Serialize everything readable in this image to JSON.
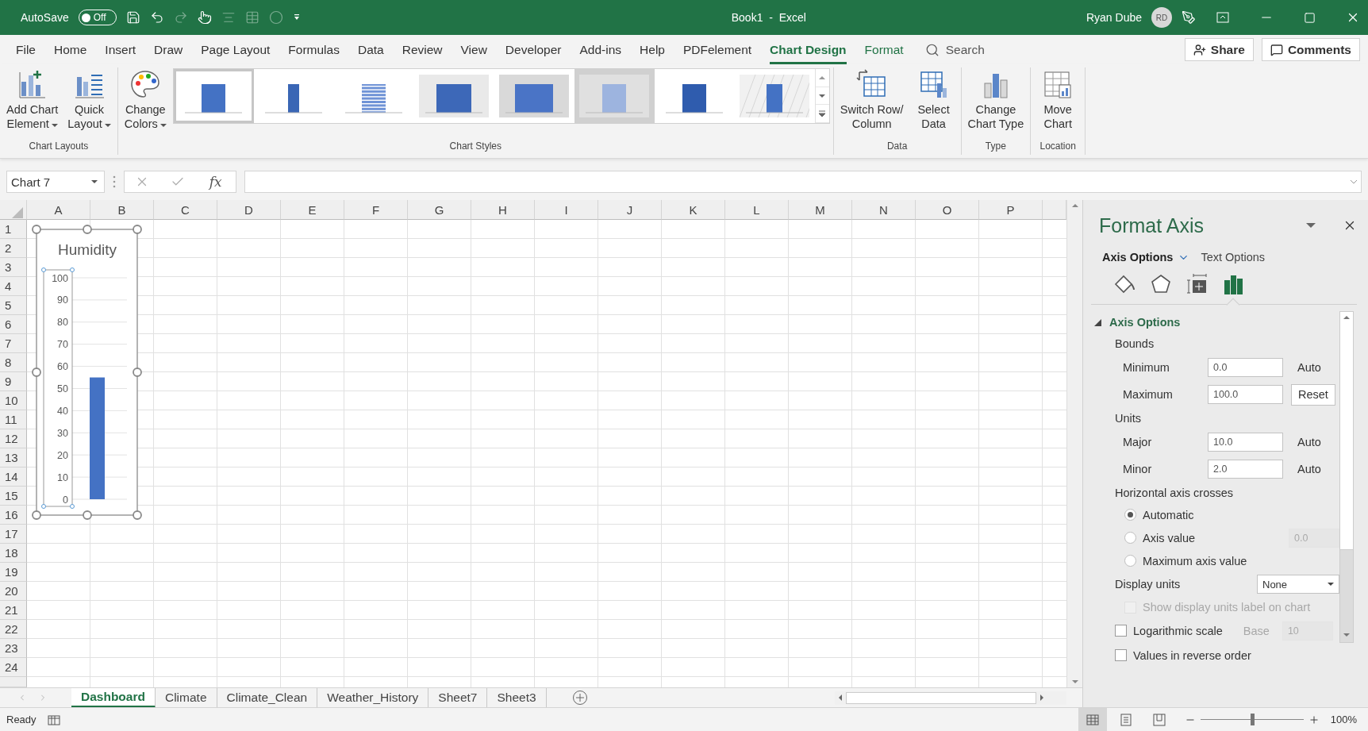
{
  "title_bar": {
    "autosave_label": "AutoSave",
    "autosave_toggle": {
      "label": "Off",
      "on": false
    },
    "quick_access": [
      {
        "kind": "save",
        "disabled": false
      },
      {
        "kind": "undo",
        "disabled": false
      },
      {
        "kind": "redo",
        "disabled": true
      },
      {
        "kind": "touch",
        "disabled": false
      },
      {
        "kind": "align",
        "disabled": true
      },
      {
        "kind": "table",
        "disabled": true
      },
      {
        "kind": "circle",
        "disabled": true
      },
      {
        "kind": "customize",
        "disabled": false
      }
    ],
    "document_title": "Book1  -  Excel",
    "user_name": "Ryan Dube",
    "user_initials": "RD"
  },
  "menu_tabs": [
    {
      "label": "File",
      "kind": "regular",
      "selected": false
    },
    {
      "label": "Home",
      "kind": "regular",
      "selected": false
    },
    {
      "label": "Insert",
      "kind": "regular",
      "selected": false
    },
    {
      "label": "Draw",
      "kind": "regular",
      "selected": false
    },
    {
      "label": "Page Layout",
      "kind": "regular",
      "selected": false
    },
    {
      "label": "Formulas",
      "kind": "regular",
      "selected": false
    },
    {
      "label": "Data",
      "kind": "regular",
      "selected": false
    },
    {
      "label": "Review",
      "kind": "regular",
      "selected": false
    },
    {
      "label": "View",
      "kind": "regular",
      "selected": false
    },
    {
      "label": "Developer",
      "kind": "regular",
      "selected": false
    },
    {
      "label": "Add-ins",
      "kind": "regular",
      "selected": false
    },
    {
      "label": "Help",
      "kind": "regular",
      "selected": false
    },
    {
      "label": "PDFelement",
      "kind": "regular",
      "selected": false
    },
    {
      "label": "Chart Design",
      "kind": "contextual",
      "selected": true
    },
    {
      "label": "Format",
      "kind": "contextual",
      "selected": false
    }
  ],
  "search": {
    "label": "Search"
  },
  "share_button": "Share",
  "comments_button": "Comments",
  "ribbon": {
    "groups": [
      {
        "label": "Chart Layouts",
        "buttons": [
          {
            "kind": "add_element",
            "lines": [
              "Add Chart",
              "Element"
            ],
            "dropdown": true
          },
          {
            "kind": "quick_layout",
            "lines": [
              "Quick",
              "Layout"
            ],
            "dropdown": true
          }
        ]
      },
      {
        "label": "Chart Styles",
        "buttons": [
          {
            "kind": "change_colors",
            "lines": [
              "Change",
              "Colors"
            ],
            "dropdown": true
          }
        ],
        "gallery": [
          {
            "kind": "plain",
            "selected": true,
            "highlighted": false
          },
          {
            "kind": "narrow",
            "selected": false,
            "highlighted": false
          },
          {
            "kind": "striped",
            "selected": false,
            "highlighted": false
          },
          {
            "kind": "gradient",
            "selected": false,
            "highlighted": false
          },
          {
            "kind": "wide",
            "selected": false,
            "highlighted": false
          },
          {
            "kind": "light",
            "selected": false,
            "highlighted": true
          },
          {
            "kind": "solid",
            "selected": false,
            "highlighted": false
          },
          {
            "kind": "hatched",
            "selected": false,
            "highlighted": false
          }
        ]
      },
      {
        "label": "Data",
        "buttons": [
          {
            "kind": "switch_row",
            "lines": [
              "Switch Row/",
              "Column"
            ],
            "dropdown": false
          },
          {
            "kind": "select_data",
            "lines": [
              "Select",
              "Data"
            ],
            "dropdown": false
          }
        ]
      },
      {
        "label": "Type",
        "buttons": [
          {
            "kind": "change_type",
            "lines": [
              "Change",
              "Chart Type"
            ],
            "dropdown": false
          }
        ]
      },
      {
        "label": "Location",
        "buttons": [
          {
            "kind": "move_chart",
            "lines": [
              "Move",
              "Chart"
            ],
            "dropdown": false
          }
        ]
      }
    ]
  },
  "formula_bar": {
    "name_box": "Chart 7",
    "function_button": "fx"
  },
  "sheet": {
    "columns": [
      "A",
      "B",
      "C",
      "D",
      "E",
      "F",
      "G",
      "H",
      "I",
      "J",
      "K",
      "L",
      "M",
      "N",
      "O",
      "P"
    ],
    "rows": [
      "1",
      "2",
      "3",
      "4",
      "5",
      "6",
      "7",
      "8",
      "9",
      "10",
      "11",
      "12",
      "13",
      "14",
      "15",
      "16",
      "17",
      "18",
      "19",
      "20",
      "21",
      "22",
      "23",
      "24"
    ],
    "chart": {
      "chart_data": {
        "type": "bar",
        "grid": true,
        "title": "Humidity",
        "values": [
          55
        ],
        "ylim": [
          0,
          100
        ],
        "yticks": [
          0,
          10,
          20,
          30,
          40,
          50,
          60,
          70,
          80,
          90,
          100
        ]
      }
    }
  },
  "sheet_tabs": [
    {
      "label": "Dashboard",
      "selected": true
    },
    {
      "label": "Climate",
      "selected": false
    },
    {
      "label": "Climate_Clean",
      "selected": false
    },
    {
      "label": "Weather_History",
      "selected": false
    },
    {
      "label": "Sheet7",
      "selected": false
    },
    {
      "label": "Sheet3",
      "selected": false
    }
  ],
  "pane": {
    "title": "Format Axis",
    "tabs": [
      {
        "label": "Axis Options",
        "selected": true
      },
      {
        "label": "Text Options",
        "selected": false
      }
    ],
    "icon_tabs": [
      {
        "kind": "fill",
        "selected": false
      },
      {
        "kind": "effects",
        "selected": false
      },
      {
        "kind": "size",
        "selected": false
      },
      {
        "kind": "axis",
        "selected": true
      }
    ],
    "section": {
      "title": "Axis Options",
      "expanded": true
    },
    "rows": [
      {
        "kind": "heading",
        "label": "Bounds"
      },
      {
        "kind": "field",
        "label": "Minimum",
        "value": "0.0",
        "action": {
          "kind": "text",
          "label": "Auto"
        }
      },
      {
        "kind": "field",
        "label": "Maximum",
        "value": "100.0",
        "action": {
          "kind": "button",
          "label": "Reset"
        }
      },
      {
        "kind": "heading",
        "label": "Units"
      },
      {
        "kind": "field",
        "label": "Major",
        "value": "10.0",
        "action": {
          "kind": "text",
          "label": "Auto"
        }
      },
      {
        "kind": "field",
        "label": "Minor",
        "value": "2.0",
        "action": {
          "kind": "text",
          "label": "Auto"
        }
      },
      {
        "kind": "heading",
        "label": "Horizontal axis crosses"
      },
      {
        "kind": "radio",
        "label": "Automatic",
        "selected": true
      },
      {
        "kind": "radio",
        "label": "Axis value",
        "selected": false,
        "value": "0.0",
        "value_disabled": true
      },
      {
        "kind": "radio",
        "label": "Maximum axis value",
        "selected": false
      },
      {
        "kind": "dropdown",
        "label": "Display units",
        "value": "None",
        "children": [
          {
            "kind": "checkbox",
            "label": "Show display units label on chart",
            "checked": false,
            "disabled": true
          }
        ]
      },
      {
        "kind": "checkbox",
        "label": "Logarithmic scale",
        "checked": false,
        "disabled": false,
        "extra": {
          "label": "Base",
          "value": "10",
          "disabled": true
        }
      },
      {
        "kind": "checkbox",
        "label": "Values in reverse order",
        "checked": false,
        "disabled": false
      }
    ]
  },
  "status_bar": {
    "status": "Ready",
    "views": [
      {
        "kind": "normal",
        "selected": true
      },
      {
        "kind": "page_layout",
        "selected": false
      },
      {
        "kind": "page_break",
        "selected": false
      }
    ],
    "zoom": {
      "level": 0.5,
      "reading": "100%"
    }
  }
}
